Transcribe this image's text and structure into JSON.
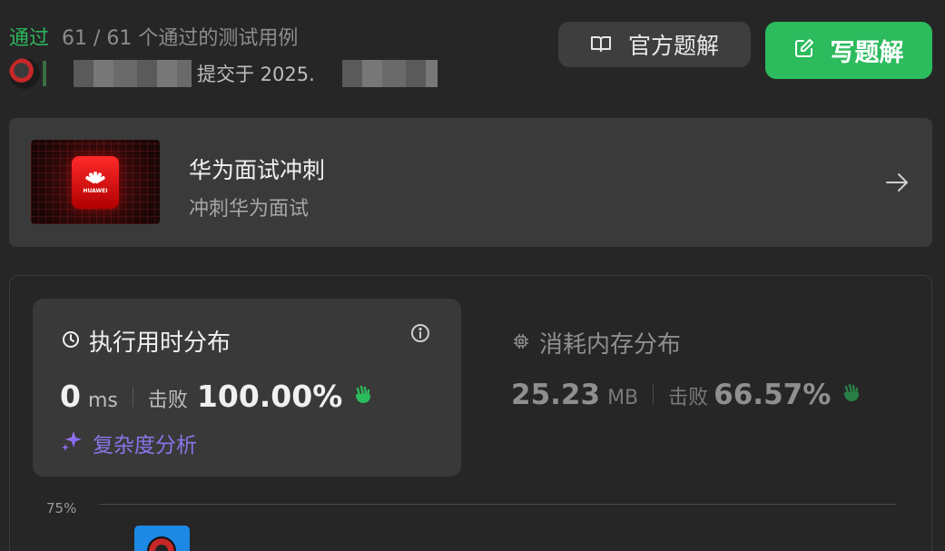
{
  "status": {
    "result": "通过",
    "cases": "61 / 61 个通过的测试用例"
  },
  "submission": {
    "submitted_prefix": "提交于 2025."
  },
  "buttons": {
    "official_solution": "官方题解",
    "write_solution": "写题解"
  },
  "promo": {
    "title": "华为面试冲刺",
    "subtitle": "冲刺华为面试",
    "logo_text": "HUAWEI"
  },
  "runtime": {
    "title": "执行用时分布",
    "value": "0",
    "unit": "ms",
    "beats_label": "击败",
    "beats_value": "100.00%",
    "complexity_label": "复杂度分析"
  },
  "memory": {
    "title": "消耗内存分布",
    "value": "25.23",
    "unit": "MB",
    "beats_label": "击败",
    "beats_value": "66.57%"
  },
  "chart": {
    "y_tick": "75%"
  },
  "colors": {
    "accent_green": "#2cbb5d",
    "pass_green": "#2db55d",
    "complexity_purple": "#8a74e8",
    "bar_blue": "#1e88e5"
  },
  "icons": {
    "solution": "book-open-icon",
    "write": "edit-icon",
    "promo_arrow": "arrow-right-icon",
    "runtime": "clock-icon",
    "info": "info-icon",
    "memory": "chip-icon",
    "beats": "clap-icon",
    "complexity": "sparkle-icon"
  }
}
